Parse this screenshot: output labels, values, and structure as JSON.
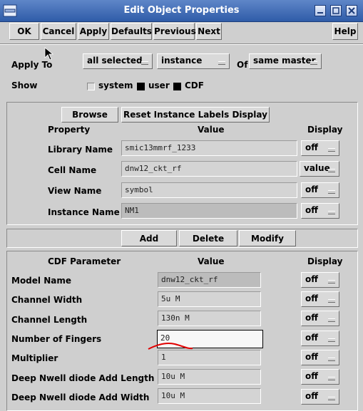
{
  "window": {
    "title": "Edit Object Properties",
    "controls": [
      "minimize-icon",
      "maximize-icon",
      "close-icon"
    ],
    "app_icon": "window-menu-icon"
  },
  "toolbar": {
    "ok": "OK",
    "cancel": "Cancel",
    "apply": "Apply",
    "defaults": "Defaults",
    "previous": "Previous",
    "next": "Next",
    "help": "Help"
  },
  "apply_to": {
    "label": "Apply To",
    "scope": "all selected",
    "type": "instance",
    "of_label": "Of",
    "master": "same master"
  },
  "show": {
    "label": "Show",
    "options": [
      {
        "label": "system",
        "checked": false
      },
      {
        "label": "user",
        "checked": true
      },
      {
        "label": "CDF",
        "checked": true
      }
    ]
  },
  "instance_section": {
    "browse": "Browse",
    "reset": "Reset Instance Labels Display",
    "headers": {
      "property": "Property",
      "value": "Value",
      "display": "Display"
    },
    "rows": [
      {
        "label": "Library Name",
        "value": "smic13mmrf_1233",
        "display": "off"
      },
      {
        "label": "Cell Name",
        "value": "dnw12_ckt_rf",
        "display": "value"
      },
      {
        "label": "View Name",
        "value": "symbol",
        "display": "off"
      },
      {
        "label": "Instance Name",
        "value": "NM1",
        "display": "off"
      }
    ]
  },
  "actions": {
    "add": "Add",
    "delete": "Delete",
    "modify": "Modify"
  },
  "cdf_section": {
    "headers": {
      "param": "CDF Parameter",
      "value": "Value",
      "display": "Display"
    },
    "rows": [
      {
        "label": "Model Name",
        "value": "dnw12_ckt_rf",
        "display": "off"
      },
      {
        "label": "Channel Width",
        "value": "5u M",
        "display": "off"
      },
      {
        "label": "Channel Length",
        "value": "130n M",
        "display": "off"
      },
      {
        "label": "Number of Fingers",
        "value": "20",
        "display": "off"
      },
      {
        "label": "Multiplier",
        "value": "1",
        "display": "off"
      },
      {
        "label": "Deep Nwell diode Add Length",
        "value": "10u M",
        "display": "off"
      },
      {
        "label": "Deep Nwell diode Add Width",
        "value": "10u M",
        "display": "off"
      }
    ]
  },
  "colors": {
    "titlebar": "#3e6bb8",
    "window_bg": "#cfcfcf",
    "annotation": "#e00000"
  }
}
